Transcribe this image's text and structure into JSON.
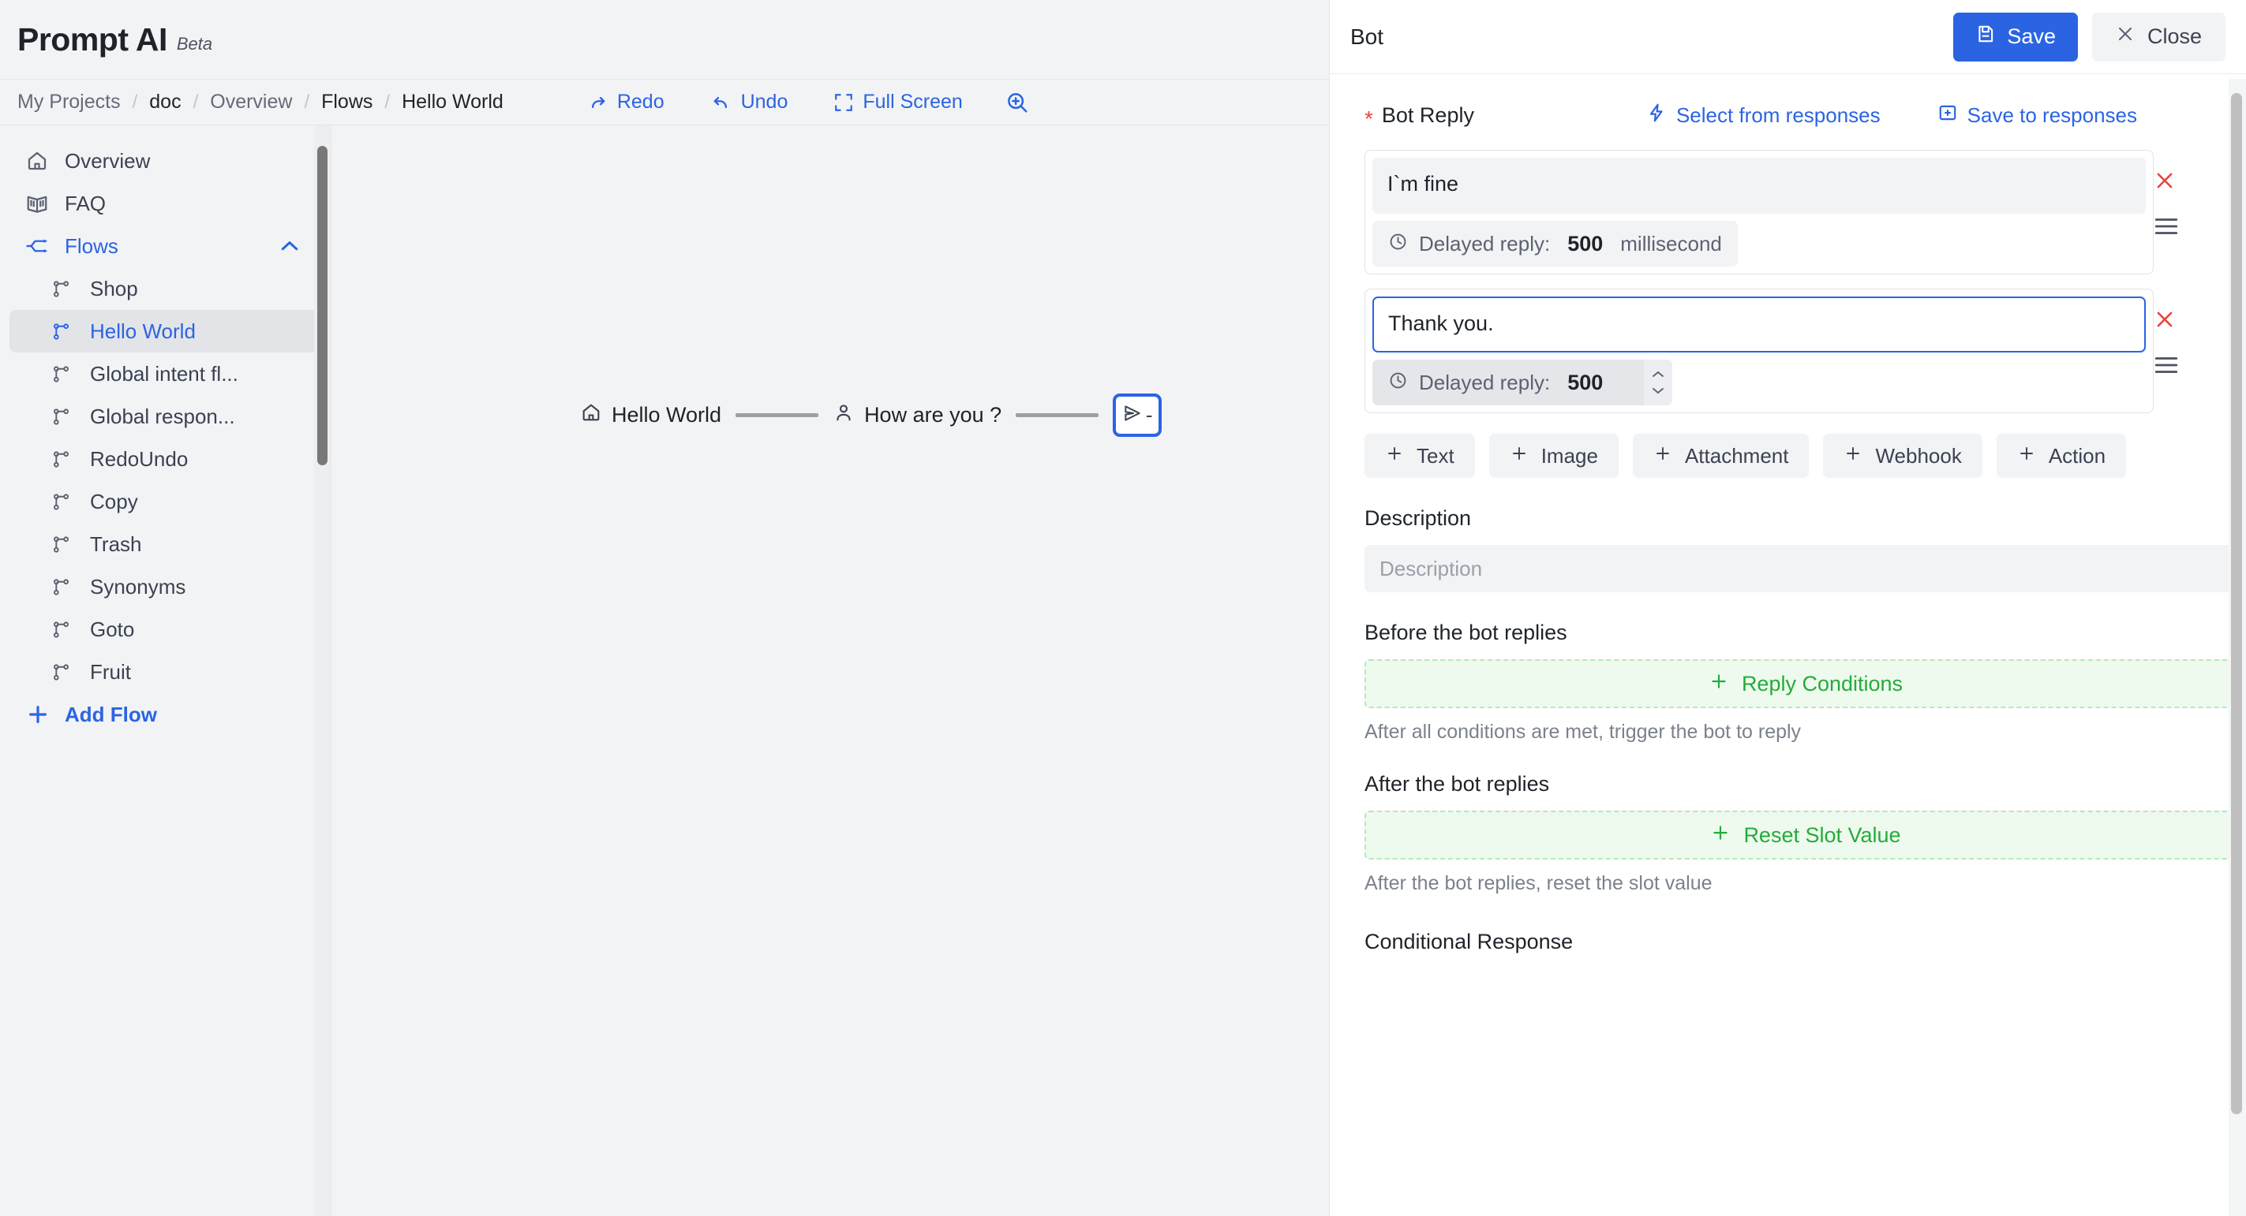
{
  "brand": {
    "title": "Prompt AI",
    "badge": "Beta"
  },
  "breadcrumb": {
    "items": [
      "My Projects",
      "doc",
      "Overview",
      "Flows",
      "Hello World"
    ],
    "separator": "/"
  },
  "toolbar": {
    "redo_label": "Redo",
    "undo_label": "Undo",
    "fullscreen_label": "Full Screen",
    "zoom_icon": "zoom-in-icon"
  },
  "sidebar": {
    "items": [
      {
        "label": "Overview",
        "icon": "home-icon",
        "level": 0,
        "active": false
      },
      {
        "label": "FAQ",
        "icon": "book-icon",
        "level": 0,
        "active": false
      },
      {
        "label": "Flows",
        "icon": "flows-icon",
        "level": 0,
        "active": false,
        "accent": true,
        "expanded": true,
        "chevron": "chevron-up-icon"
      },
      {
        "label": "Shop",
        "icon": "flow-branch-icon",
        "level": 1,
        "active": false
      },
      {
        "label": "Hello World",
        "icon": "flow-branch-icon",
        "level": 1,
        "active": true
      },
      {
        "label": "Global intent fl...",
        "icon": "flow-branch-icon",
        "level": 1,
        "active": false
      },
      {
        "label": "Global respon...",
        "icon": "flow-branch-icon",
        "level": 1,
        "active": false
      },
      {
        "label": "RedoUndo",
        "icon": "flow-branch-icon",
        "level": 1,
        "active": false
      },
      {
        "label": "Copy",
        "icon": "flow-branch-icon",
        "level": 1,
        "active": false
      },
      {
        "label": "Trash",
        "icon": "flow-branch-icon",
        "level": 1,
        "active": false
      },
      {
        "label": "Synonyms",
        "icon": "flow-branch-icon",
        "level": 1,
        "active": false
      },
      {
        "label": "Goto",
        "icon": "flow-branch-icon",
        "level": 1,
        "active": false
      },
      {
        "label": "Fruit",
        "icon": "flow-branch-icon",
        "level": 1,
        "active": false
      }
    ],
    "add_flow_label": "Add Flow"
  },
  "canvas": {
    "nodes": [
      {
        "label": "Hello World",
        "icon": "home-icon"
      },
      {
        "label": "How are you ?",
        "icon": "user-icon"
      }
    ],
    "end_node": {
      "icon": "send-icon",
      "label": "-"
    }
  },
  "panel": {
    "title": "Bot",
    "save_label": "Save",
    "close_label": "Close",
    "bot_reply": {
      "label": "Bot Reply",
      "required_marker": "*",
      "select_from_responses": "Select from responses",
      "save_to_responses": "Save to responses",
      "replies": [
        {
          "text": "I`m fine",
          "focused": false,
          "delay_label": "Delayed reply:",
          "delay_value": "500",
          "delay_unit": "millisecond",
          "has_stepper": false
        },
        {
          "text": "Thank you.",
          "focused": true,
          "delay_label": "Delayed reply:",
          "delay_value": "500",
          "delay_unit": "",
          "has_stepper": true
        }
      ]
    },
    "add_buttons": [
      "Text",
      "Image",
      "Attachment",
      "Webhook",
      "Action"
    ],
    "description": {
      "label": "Description",
      "value": "",
      "placeholder": "Description"
    },
    "before_replies": {
      "label": "Before the bot replies",
      "action": "Reply Conditions",
      "hint": "After all conditions are met, trigger the bot to reply"
    },
    "after_replies": {
      "label": "After the bot replies",
      "action": "Reset Slot Value",
      "hint": "After the bot replies, reset the slot value"
    },
    "conditional_response": {
      "label": "Conditional Response"
    }
  },
  "colors": {
    "accent": "#2b64e3",
    "green": "#25ab3b",
    "danger": "#e8453c",
    "panel_bg": "#ffffff",
    "app_bg": "#f2f3f5"
  }
}
